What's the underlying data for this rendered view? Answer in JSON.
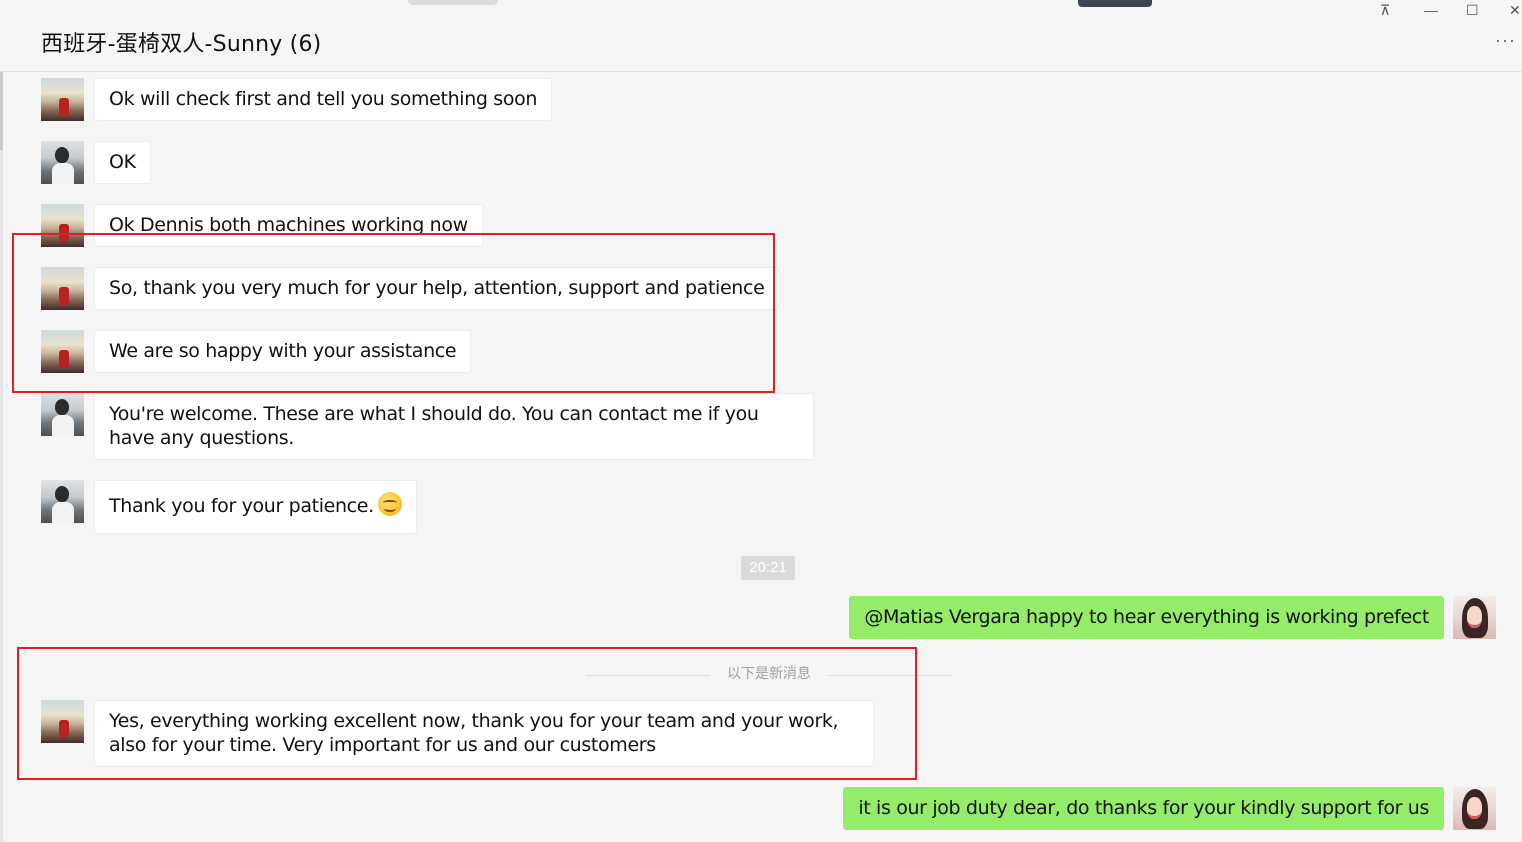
{
  "header": {
    "title": "西班牙-蛋椅双人-Sunny (6)",
    "pin_icon": "pin-icon",
    "minimize_icon": "minimize-icon",
    "maximize_icon": "maximize-icon",
    "close_icon": "close-icon",
    "more_icon": "more-icon",
    "pin_glyph": "⊼",
    "minimize_glyph": "—",
    "maximize_glyph": "☐",
    "close_glyph": "✕",
    "more_glyph": "···"
  },
  "messages": [
    {
      "sender": "customer",
      "text": "Ok will check first and tell you something soon"
    },
    {
      "sender": "dennis",
      "text": "OK"
    },
    {
      "sender": "customer",
      "text": "Ok Dennis both machines working now"
    },
    {
      "sender": "customer",
      "text": "So, thank you very much for your help, attention, support and patience"
    },
    {
      "sender": "customer",
      "text": "We are so happy with your assistance"
    },
    {
      "sender": "dennis",
      "text": "You're welcome. These are what I should do. You can contact me if you have any questions."
    },
    {
      "sender": "dennis",
      "text": "Thank you for your patience.",
      "emoji": "smile-emoji"
    },
    {
      "sender": "sunny",
      "text": "@Matias Vergara happy to hear everything is working prefect"
    },
    {
      "sender": "customer",
      "text": "Yes, everything working excellent now, thank you for your team and your work, also for your time. Very important for us and our customers"
    },
    {
      "sender": "sunny",
      "text": "it is our job duty dear, do thanks for your kindly support for us"
    }
  ],
  "timestamp": "20:21",
  "new_messages_divider": "以下是新消息",
  "colors": {
    "background": "#f5f5f5",
    "incoming_bubble": "#ffffff",
    "outgoing_bubble": "#95ec69",
    "highlight_box": "#e02020"
  }
}
